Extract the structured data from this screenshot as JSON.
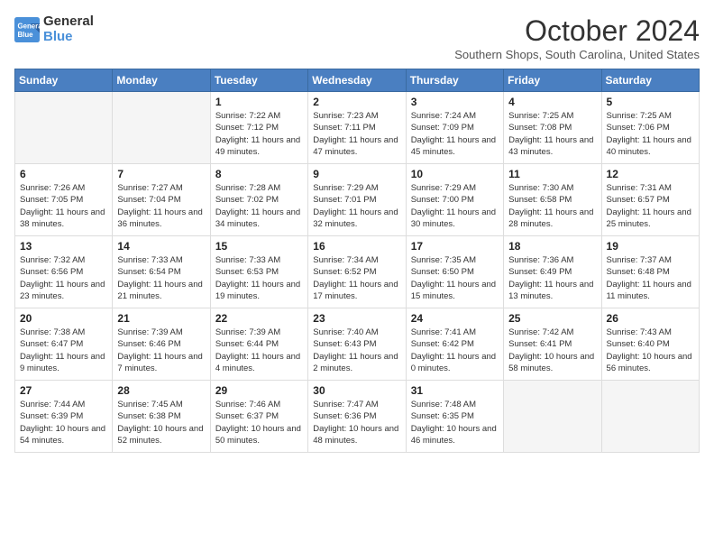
{
  "header": {
    "logo_line1": "General",
    "logo_line2": "Blue",
    "month": "October 2024",
    "location": "Southern Shops, South Carolina, United States"
  },
  "weekdays": [
    "Sunday",
    "Monday",
    "Tuesday",
    "Wednesday",
    "Thursday",
    "Friday",
    "Saturday"
  ],
  "weeks": [
    [
      {
        "day": "",
        "detail": ""
      },
      {
        "day": "",
        "detail": ""
      },
      {
        "day": "1",
        "detail": "Sunrise: 7:22 AM\nSunset: 7:12 PM\nDaylight: 11 hours and 49 minutes."
      },
      {
        "day": "2",
        "detail": "Sunrise: 7:23 AM\nSunset: 7:11 PM\nDaylight: 11 hours and 47 minutes."
      },
      {
        "day": "3",
        "detail": "Sunrise: 7:24 AM\nSunset: 7:09 PM\nDaylight: 11 hours and 45 minutes."
      },
      {
        "day": "4",
        "detail": "Sunrise: 7:25 AM\nSunset: 7:08 PM\nDaylight: 11 hours and 43 minutes."
      },
      {
        "day": "5",
        "detail": "Sunrise: 7:25 AM\nSunset: 7:06 PM\nDaylight: 11 hours and 40 minutes."
      }
    ],
    [
      {
        "day": "6",
        "detail": "Sunrise: 7:26 AM\nSunset: 7:05 PM\nDaylight: 11 hours and 38 minutes."
      },
      {
        "day": "7",
        "detail": "Sunrise: 7:27 AM\nSunset: 7:04 PM\nDaylight: 11 hours and 36 minutes."
      },
      {
        "day": "8",
        "detail": "Sunrise: 7:28 AM\nSunset: 7:02 PM\nDaylight: 11 hours and 34 minutes."
      },
      {
        "day": "9",
        "detail": "Sunrise: 7:29 AM\nSunset: 7:01 PM\nDaylight: 11 hours and 32 minutes."
      },
      {
        "day": "10",
        "detail": "Sunrise: 7:29 AM\nSunset: 7:00 PM\nDaylight: 11 hours and 30 minutes."
      },
      {
        "day": "11",
        "detail": "Sunrise: 7:30 AM\nSunset: 6:58 PM\nDaylight: 11 hours and 28 minutes."
      },
      {
        "day": "12",
        "detail": "Sunrise: 7:31 AM\nSunset: 6:57 PM\nDaylight: 11 hours and 25 minutes."
      }
    ],
    [
      {
        "day": "13",
        "detail": "Sunrise: 7:32 AM\nSunset: 6:56 PM\nDaylight: 11 hours and 23 minutes."
      },
      {
        "day": "14",
        "detail": "Sunrise: 7:33 AM\nSunset: 6:54 PM\nDaylight: 11 hours and 21 minutes."
      },
      {
        "day": "15",
        "detail": "Sunrise: 7:33 AM\nSunset: 6:53 PM\nDaylight: 11 hours and 19 minutes."
      },
      {
        "day": "16",
        "detail": "Sunrise: 7:34 AM\nSunset: 6:52 PM\nDaylight: 11 hours and 17 minutes."
      },
      {
        "day": "17",
        "detail": "Sunrise: 7:35 AM\nSunset: 6:50 PM\nDaylight: 11 hours and 15 minutes."
      },
      {
        "day": "18",
        "detail": "Sunrise: 7:36 AM\nSunset: 6:49 PM\nDaylight: 11 hours and 13 minutes."
      },
      {
        "day": "19",
        "detail": "Sunrise: 7:37 AM\nSunset: 6:48 PM\nDaylight: 11 hours and 11 minutes."
      }
    ],
    [
      {
        "day": "20",
        "detail": "Sunrise: 7:38 AM\nSunset: 6:47 PM\nDaylight: 11 hours and 9 minutes."
      },
      {
        "day": "21",
        "detail": "Sunrise: 7:39 AM\nSunset: 6:46 PM\nDaylight: 11 hours and 7 minutes."
      },
      {
        "day": "22",
        "detail": "Sunrise: 7:39 AM\nSunset: 6:44 PM\nDaylight: 11 hours and 4 minutes."
      },
      {
        "day": "23",
        "detail": "Sunrise: 7:40 AM\nSunset: 6:43 PM\nDaylight: 11 hours and 2 minutes."
      },
      {
        "day": "24",
        "detail": "Sunrise: 7:41 AM\nSunset: 6:42 PM\nDaylight: 11 hours and 0 minutes."
      },
      {
        "day": "25",
        "detail": "Sunrise: 7:42 AM\nSunset: 6:41 PM\nDaylight: 10 hours and 58 minutes."
      },
      {
        "day": "26",
        "detail": "Sunrise: 7:43 AM\nSunset: 6:40 PM\nDaylight: 10 hours and 56 minutes."
      }
    ],
    [
      {
        "day": "27",
        "detail": "Sunrise: 7:44 AM\nSunset: 6:39 PM\nDaylight: 10 hours and 54 minutes."
      },
      {
        "day": "28",
        "detail": "Sunrise: 7:45 AM\nSunset: 6:38 PM\nDaylight: 10 hours and 52 minutes."
      },
      {
        "day": "29",
        "detail": "Sunrise: 7:46 AM\nSunset: 6:37 PM\nDaylight: 10 hours and 50 minutes."
      },
      {
        "day": "30",
        "detail": "Sunrise: 7:47 AM\nSunset: 6:36 PM\nDaylight: 10 hours and 48 minutes."
      },
      {
        "day": "31",
        "detail": "Sunrise: 7:48 AM\nSunset: 6:35 PM\nDaylight: 10 hours and 46 minutes."
      },
      {
        "day": "",
        "detail": ""
      },
      {
        "day": "",
        "detail": ""
      }
    ]
  ]
}
